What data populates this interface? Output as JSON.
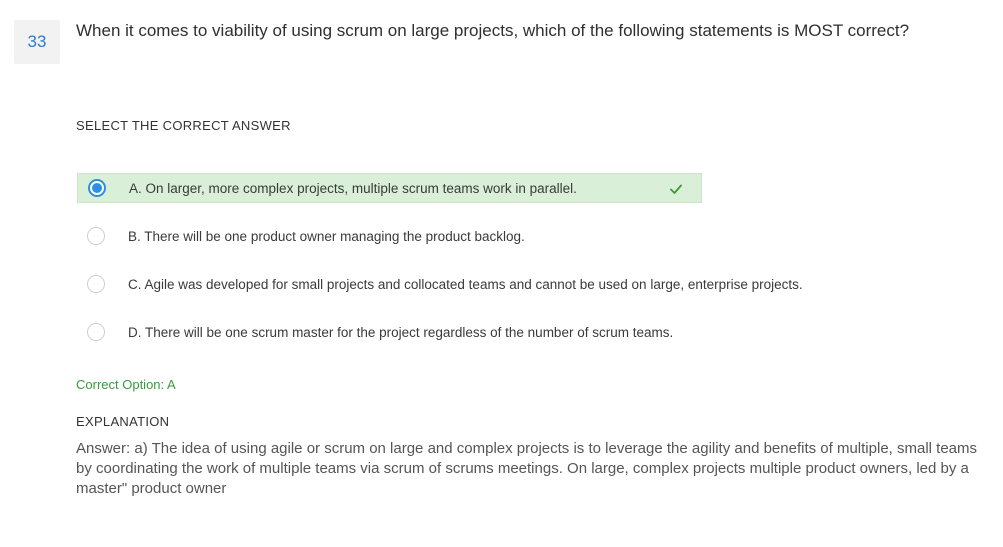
{
  "question": {
    "number": "33",
    "text": "When it comes to viability of using scrum on large projects, which of the following statements is MOST correct?"
  },
  "select_label": "SELECT THE CORRECT ANSWER",
  "options": [
    {
      "text": "A. On larger, more complex projects, multiple scrum teams work in parallel.",
      "selected": true,
      "correct": true
    },
    {
      "text": "B. There will be one product owner managing the product backlog.",
      "selected": false,
      "correct": false
    },
    {
      "text": "C. Agile was developed for small projects and collocated teams and cannot be used on large, enterprise projects.",
      "selected": false,
      "correct": false
    },
    {
      "text": "D. There will be one scrum master for the project regardless of the number of scrum teams.",
      "selected": false,
      "correct": false
    }
  ],
  "correct_option": "Correct Option: A",
  "explanation": {
    "label": "EXPLANATION",
    "text": "Answer: a) The idea of using agile or scrum on large and complex projects is to leverage the agility and benefits of multiple, small teams by coordinating the work of multiple teams via scrum of scrums meetings. On large, complex projects multiple product owners, led by a master\" product owner"
  },
  "colors": {
    "accent": "#2d8fe0",
    "correct_bg": "#d9efd8",
    "correct_text": "#3a9a3a"
  }
}
